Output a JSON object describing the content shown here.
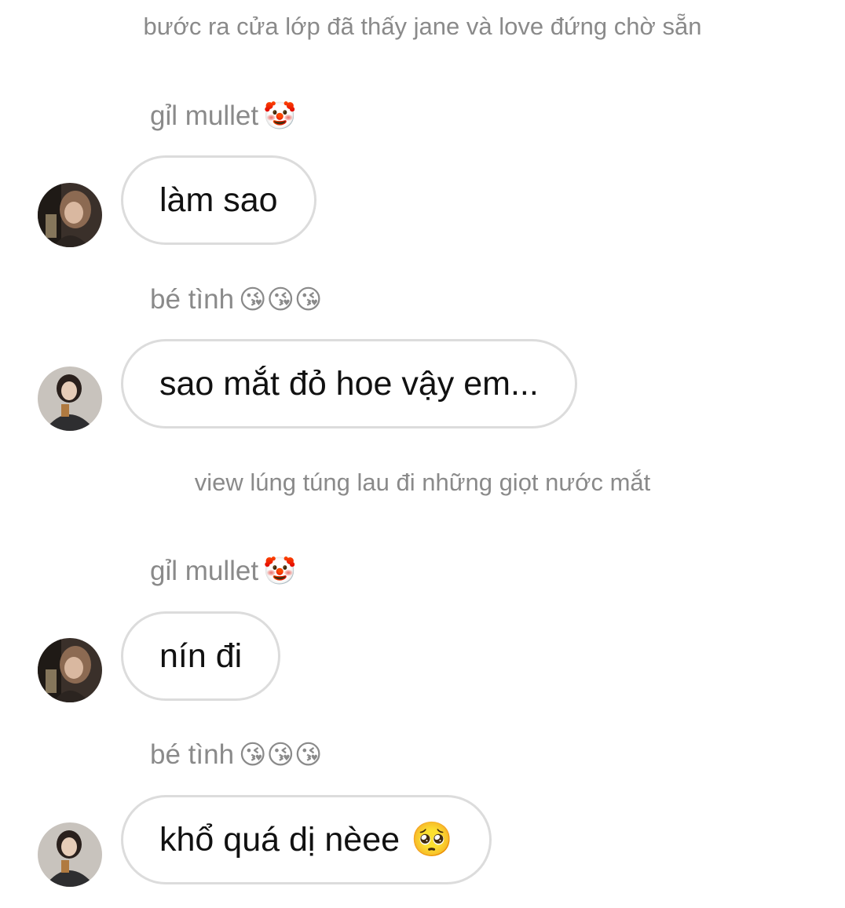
{
  "narration": [
    "bước ra cửa lớp đã thấy jane và love đứng chờ sẵn",
    "view lúng túng lau đi những giọt nước mắt"
  ],
  "messages": [
    {
      "sender": "gỉl mullet",
      "sender_emoji": "🤡",
      "text": "làm sao",
      "avatar": "avatar-mullet"
    },
    {
      "sender": "bé tình",
      "sender_emoji": "😘😘😘",
      "text": "sao mắt đỏ hoe vậy em...",
      "avatar": "avatar-betinh"
    },
    {
      "sender": "gỉl mullet",
      "sender_emoji": "🤡",
      "text": "nín đi",
      "avatar": "avatar-mullet"
    },
    {
      "sender": "bé tình",
      "sender_emoji": "😘😘😘",
      "text": "khổ quá dị nèee",
      "text_emoji": "🥺",
      "avatar": "avatar-betinh"
    }
  ],
  "colors": {
    "background": "#ffffff",
    "meta_text": "#8a8a8a",
    "bubble_border": "#dcdcdc",
    "message_text": "#111111"
  }
}
